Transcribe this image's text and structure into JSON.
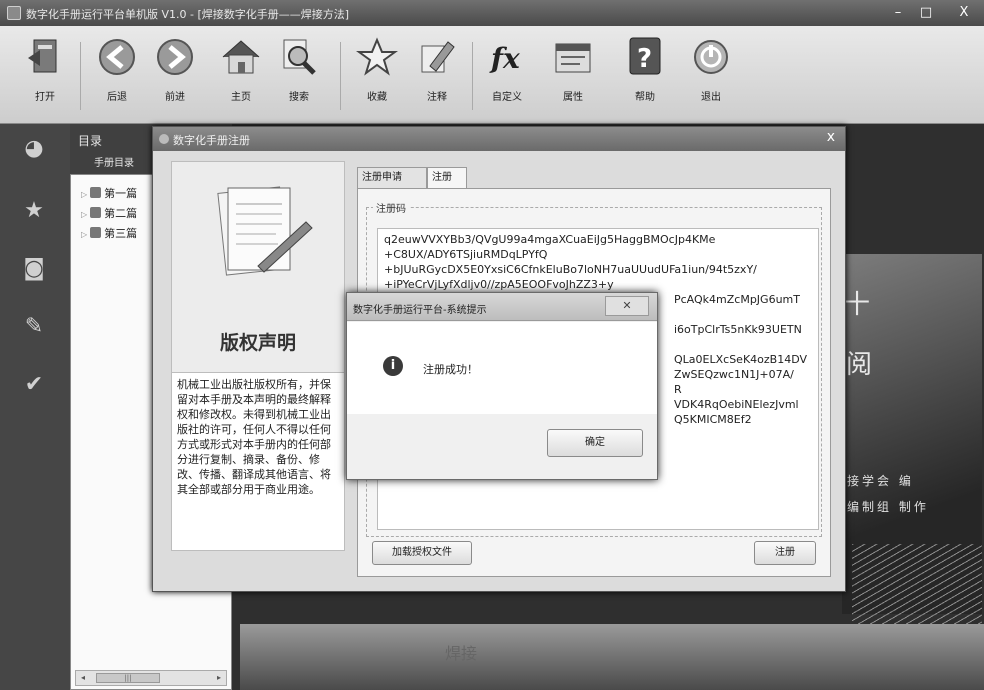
{
  "window": {
    "title": "数字化手册运行平台单机版 V1.0 - [焊接数字化手册——焊接方法]",
    "minimize": "–",
    "maximize": "□",
    "close": "X"
  },
  "toolbar": [
    {
      "key": "open",
      "label": "打开",
      "icon": "open-icon"
    },
    {
      "key": "back",
      "label": "后退",
      "icon": "back-arrow-icon"
    },
    {
      "key": "forward",
      "label": "前进",
      "icon": "forward-arrow-icon"
    },
    {
      "key": "home",
      "label": "主页",
      "icon": "home-icon"
    },
    {
      "key": "search",
      "label": "搜索",
      "icon": "search-icon"
    },
    {
      "key": "favorites",
      "label": "收藏",
      "icon": "star-icon"
    },
    {
      "key": "annotate",
      "label": "注释",
      "icon": "pen-icon"
    },
    {
      "key": "custom",
      "label": "自定义",
      "icon": "fx-icon"
    },
    {
      "key": "properties",
      "label": "属性",
      "icon": "properties-icon"
    },
    {
      "key": "help",
      "label": "帮助",
      "icon": "help-icon"
    },
    {
      "key": "exit",
      "label": "退出",
      "icon": "power-icon"
    }
  ],
  "sidebar": {
    "catalog_title": "目录",
    "catalog_subtitle": "手册目录",
    "tree_items": [
      "第一篇",
      "第二篇",
      "第三篇"
    ]
  },
  "background": {
    "char_1": "十",
    "char_2": "阅",
    "line_1": "焊接学会  编",
    "line_2": "册编制组  制作",
    "bottom_label": "焊接"
  },
  "dialog": {
    "title": "数字化手册注册",
    "close": "x",
    "copyright_title": "版权声明",
    "copyright_text": "机械工业出版社版权所有，并保留对本手册及本声明的最终解释权和修改权。未得到机械工业出版社的许可，任何人不得以任何方式或形式对本手册内的任何部分进行复制、摘录、备份、修改、传播、翻译成其他语言、将其全部或部分用于商业用途。",
    "tabs": [
      "注册申请",
      "注册"
    ],
    "group_label": "注册码",
    "code_lines": [
      "q2euwVVXYBb3/QVgU99a4mgaXCuaEiJg5HaggBMOcJp4KMe",
      "+C8UX/ADY6TSjiuRMDqLPYfQ",
      "+bJUuRGycDX5E0YxsiC6CfnkEluBo7loNH7uaUUudUFa1iun/94t5zxY/",
      "+iPYeCrVjLyfXdljv0//zpA5EOOFvoJhZZ3+y",
      "PcAQk4mZcMpJG6umT",
      "",
      "i6oTpClrTs5nKk93UETN",
      "",
      "QLa0ELXcSeK4ozB14DV",
      "ZwSEQzwc1N1J+07A/",
      "R",
      "VDK4RqOebiNElezJvml",
      "Q5KMICM8Ef2"
    ],
    "load_button": "加载授权文件",
    "register_button": "注册"
  },
  "message_box": {
    "title": "数字化手册运行平台-系统提示",
    "close": "✕",
    "icon": "info-icon",
    "text": "注册成功！",
    "ok": "确定"
  }
}
